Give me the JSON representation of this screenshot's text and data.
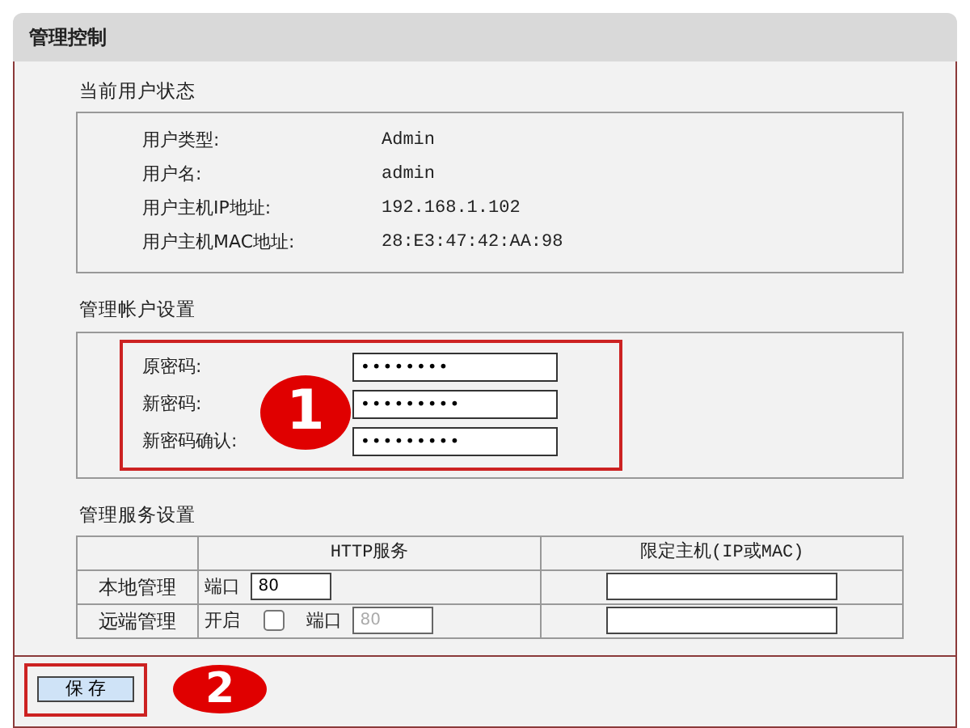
{
  "panel": {
    "title": "管理控制"
  },
  "user_status": {
    "title": "当前用户状态",
    "rows": [
      {
        "label": "用户类型:",
        "value": "Admin"
      },
      {
        "label": "用户名:",
        "value": "admin"
      },
      {
        "label": "用户主机IP地址:",
        "value": "192.168.1.102"
      },
      {
        "label": "用户主机MAC地址:",
        "value": "28:E3:47:42:AA:98"
      }
    ]
  },
  "account": {
    "title": "管理帐户设置",
    "fields": [
      {
        "label": "原密码:",
        "value": "••••••••"
      },
      {
        "label": "新密码:",
        "value": "•••••••••"
      },
      {
        "label": "新密码确认:",
        "value": "•••••••••"
      }
    ],
    "annotation": "1"
  },
  "service": {
    "title": "管理服务设置",
    "columns": [
      "HTTP服务",
      "限定主机(IP或MAC)"
    ],
    "rows": [
      {
        "label": "本地管理",
        "kind": "local",
        "port_label": "端口",
        "port": "80",
        "port_disabled": false
      },
      {
        "label": "远端管理",
        "kind": "remote",
        "enable_label": "开启",
        "checked": false,
        "port_label": "端口",
        "port": "80",
        "port_disabled": true
      }
    ]
  },
  "save_button": {
    "label": "保 存",
    "annotation": "2"
  }
}
